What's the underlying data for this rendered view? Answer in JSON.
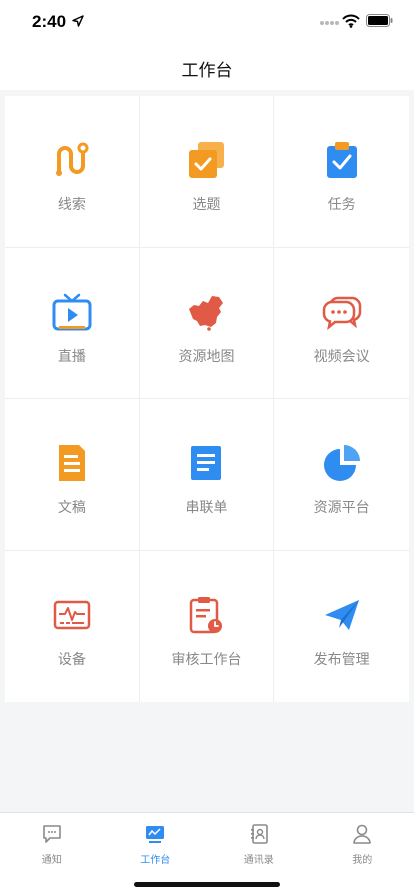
{
  "status": {
    "time": "2:40"
  },
  "header": {
    "title": "工作台"
  },
  "colors": {
    "orange": "#f29a22",
    "blue": "#2f8cf0",
    "red": "#e05a45",
    "tab_active": "#2f8cf0",
    "tab_inactive": "#8a8a8a"
  },
  "grid": {
    "items": [
      {
        "label": "线索",
        "icon": "clue-icon"
      },
      {
        "label": "选题",
        "icon": "topic-icon"
      },
      {
        "label": "任务",
        "icon": "task-clipboard-icon"
      },
      {
        "label": "直播",
        "icon": "tv-live-icon"
      },
      {
        "label": "资源地图",
        "icon": "china-map-icon"
      },
      {
        "label": "视频会议",
        "icon": "chat-bubbles-icon"
      },
      {
        "label": "文稿",
        "icon": "document-icon"
      },
      {
        "label": "串联单",
        "icon": "list-document-icon"
      },
      {
        "label": "资源平台",
        "icon": "pie-chart-icon"
      },
      {
        "label": "设备",
        "icon": "device-monitor-icon"
      },
      {
        "label": "审核工作台",
        "icon": "review-clipboard-icon"
      },
      {
        "label": "发布管理",
        "icon": "paper-plane-icon"
      }
    ]
  },
  "tabbar": {
    "items": [
      {
        "label": "通知",
        "icon": "message-icon",
        "active": false
      },
      {
        "label": "工作台",
        "icon": "workbench-icon",
        "active": true
      },
      {
        "label": "通讯录",
        "icon": "contacts-icon",
        "active": false
      },
      {
        "label": "我的",
        "icon": "profile-icon",
        "active": false
      }
    ]
  }
}
